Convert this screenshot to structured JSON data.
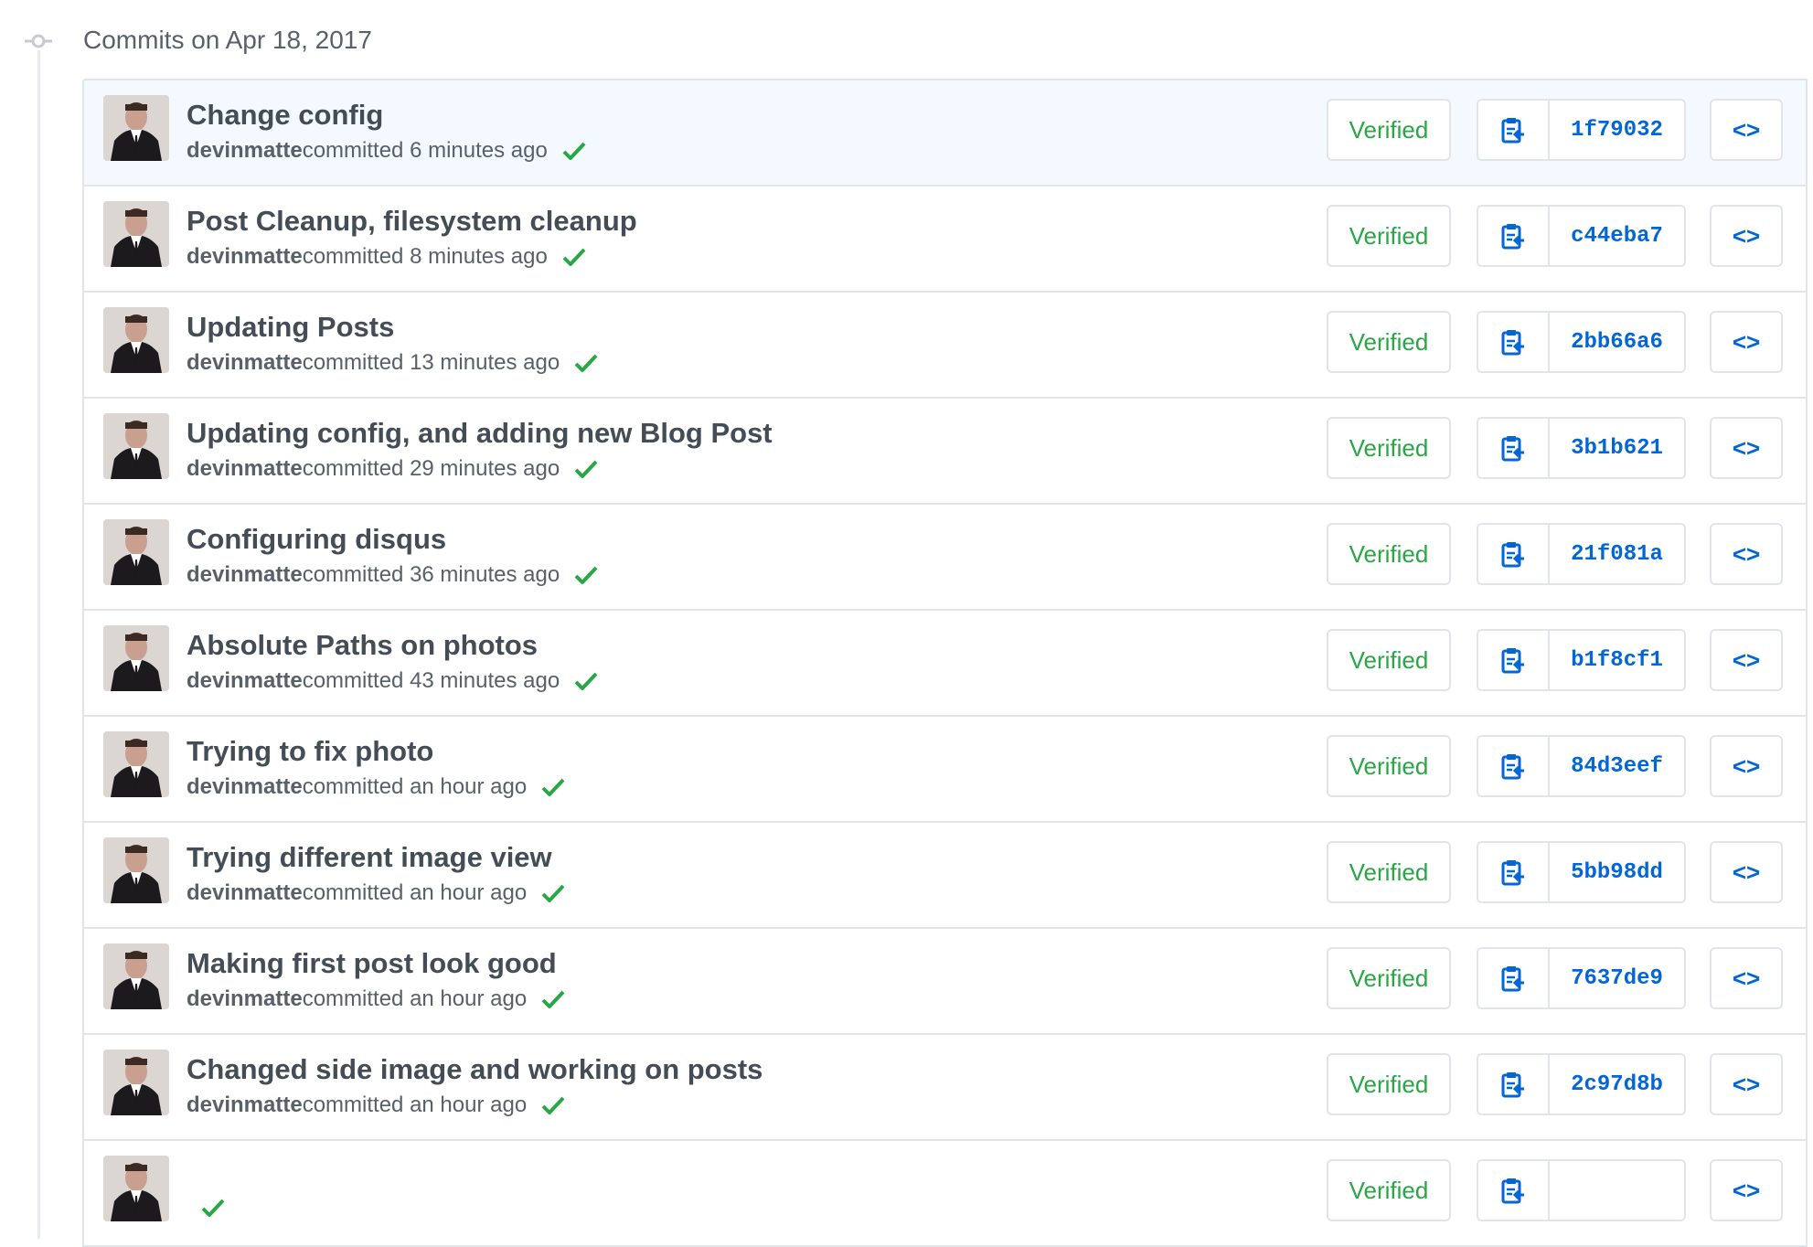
{
  "group": {
    "title": "Commits on Apr 18, 2017"
  },
  "labels": {
    "verified": "Verified",
    "browse": "<>"
  },
  "icons": {
    "timeline": "git-commit-icon",
    "copy": "clippy-icon",
    "check": "check-icon"
  },
  "colors": {
    "verified": "#28a745",
    "sha": "#0366d6",
    "check": "#28a745",
    "highlight_row": "#f3f9ff"
  },
  "commits": [
    {
      "message": "Change config",
      "author": "devinmatte",
      "time": "committed 6 minutes ago",
      "sha": "1f79032"
    },
    {
      "message": "Post Cleanup, filesystem cleanup",
      "author": "devinmatte",
      "time": "committed 8 minutes ago",
      "sha": "c44eba7"
    },
    {
      "message": "Updating Posts",
      "author": "devinmatte",
      "time": "committed 13 minutes ago",
      "sha": "2bb66a6"
    },
    {
      "message": "Updating config, and adding new Blog Post",
      "author": "devinmatte",
      "time": "committed 29 minutes ago",
      "sha": "3b1b621"
    },
    {
      "message": "Configuring disqus",
      "author": "devinmatte",
      "time": "committed 36 minutes ago",
      "sha": "21f081a"
    },
    {
      "message": "Absolute Paths on photos",
      "author": "devinmatte",
      "time": "committed 43 minutes ago",
      "sha": "b1f8cf1"
    },
    {
      "message": "Trying to fix photo",
      "author": "devinmatte",
      "time": "committed an hour ago",
      "sha": "84d3eef"
    },
    {
      "message": "Trying different image view",
      "author": "devinmatte",
      "time": "committed an hour ago",
      "sha": "5bb98dd"
    },
    {
      "message": "Making first post look good",
      "author": "devinmatte",
      "time": "committed an hour ago",
      "sha": "7637de9"
    },
    {
      "message": "Changed side image and working on posts",
      "author": "devinmatte",
      "time": "committed an hour ago",
      "sha": "2c97d8b"
    },
    {
      "message": "",
      "author": "",
      "time": "",
      "sha": ""
    }
  ]
}
